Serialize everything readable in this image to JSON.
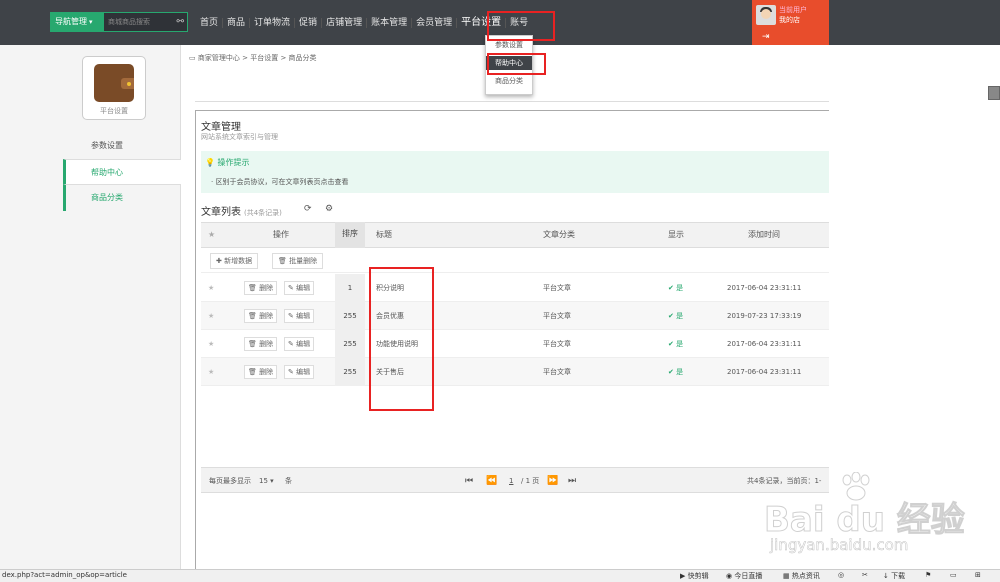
{
  "header": {
    "nav_button": "导航管理",
    "search_placeholder": "商城商品搜索",
    "menu": [
      "首页",
      "商品",
      "订单物流",
      "促销",
      "店铺管理",
      "账本管理",
      "会员管理",
      "平台设置",
      "账号"
    ],
    "user_name": "当前用户",
    "user_store": "我的店"
  },
  "dropdown": {
    "items": [
      "参数设置",
      "帮助中心",
      "商品分类"
    ],
    "active": "帮助中心"
  },
  "sidebar": {
    "logo_text": "平台设置",
    "items": [
      {
        "label": "参数设置"
      },
      {
        "label": "帮助中心"
      },
      {
        "label": "商品分类"
      }
    ]
  },
  "breadcrumb": {
    "items": [
      "商家管理中心",
      "平台设置",
      "商品分类"
    ],
    "sep": ">"
  },
  "panel": {
    "title": "文章管理",
    "subtitle": "网站系统文章索引与管理",
    "tips_title": "操作提示",
    "tips_text": "区别于会员协议，可在文章列表页点击查看"
  },
  "list": {
    "title": "文章列表",
    "count": "(共4条记录)",
    "columns": {
      "op": "操作",
      "sort": "排序",
      "title": "标题",
      "category": "文章分类",
      "show": "显示",
      "time": "添加时间"
    },
    "add_btn": "新增数据",
    "bulk_delete_btn": "批量删除",
    "delete_label": "删除",
    "edit_label": "编辑",
    "rows": [
      {
        "sort": "1",
        "title": "积分说明",
        "category": "平台文章",
        "show": "是",
        "time": "2017-06-04 23:31:11"
      },
      {
        "sort": "255",
        "title": "会员优惠",
        "category": "平台文章",
        "show": "是",
        "time": "2019-07-23 17:33:19"
      },
      {
        "sort": "255",
        "title": "功能使用说明",
        "category": "平台文章",
        "show": "是",
        "time": "2017-06-04 23:31:11"
      },
      {
        "sort": "255",
        "title": "关于售后",
        "category": "平台文章",
        "show": "是",
        "time": "2017-06-04 23:31:11"
      }
    ]
  },
  "pager": {
    "per_page_label": "每页最多显示",
    "per_page": "15",
    "per_page_unit": "条",
    "current": "1",
    "total_pages": "/ 1 页",
    "summary": "共4条记录，当前页：1-"
  },
  "statusbar": {
    "url": "dex.php?act=admin_op&op=article",
    "items": [
      "快剪辑",
      "今日直播",
      "热点资讯",
      "下载"
    ]
  },
  "watermark": {
    "logo": "Bai du 经验",
    "url": "jingyan.baidu.com"
  },
  "colors": {
    "accent": "#27a86f",
    "header": "#3f4348",
    "user": "#e84d2c",
    "highlight": "#e82222"
  }
}
